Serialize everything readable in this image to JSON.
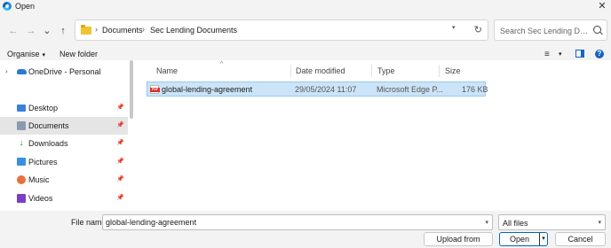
{
  "window": {
    "title": "Open",
    "close_glyph": "✕"
  },
  "nav": {
    "back_glyph": "←",
    "forward_glyph": "→",
    "recent_glyph": "⌄",
    "up_glyph": "↑",
    "refresh_glyph": "↻"
  },
  "address": {
    "breadcrumbs": [
      "Documents",
      "Sec Lending Documents"
    ],
    "separator": "›"
  },
  "search": {
    "placeholder": "Search Sec Lending Documents"
  },
  "toolbar": {
    "organise_label": "Organise",
    "new_folder_label": "New folder",
    "caret": "▾",
    "view_glyph": "≡"
  },
  "sidebar": {
    "items": [
      {
        "label": "OneDrive - Personal",
        "icon": "onedrive-icon",
        "expander": "›",
        "pinned": false
      },
      {
        "label": "Desktop",
        "icon": "desktop-icon",
        "pinned": true
      },
      {
        "label": "Documents",
        "icon": "documents-icon",
        "pinned": true,
        "selected": true
      },
      {
        "label": "Downloads",
        "icon": "downloads-icon",
        "pinned": true
      },
      {
        "label": "Pictures",
        "icon": "pictures-icon",
        "pinned": true
      },
      {
        "label": "Music",
        "icon": "music-icon",
        "pinned": true
      },
      {
        "label": "Videos",
        "icon": "videos-icon",
        "pinned": true
      }
    ],
    "pin_glyph": "📌"
  },
  "files": {
    "sort_glyph": "^",
    "columns": {
      "name": "Name",
      "date": "Date modified",
      "type": "Type",
      "size": "Size"
    },
    "rows": [
      {
        "name": "global-lending-agreement",
        "date": "29/05/2024 11:07",
        "type": "Microsoft Edge P...",
        "size": "176 KB",
        "icon": "pdf-icon",
        "selected": true
      }
    ]
  },
  "footer": {
    "file_name_label": "File name:",
    "file_name_value": "global-lending-agreement",
    "file_type_value": "All files",
    "upload_label": "Upload from mobile",
    "open_label": "Open",
    "cancel_label": "Cancel",
    "caret": "▾"
  },
  "colors": {
    "accent": "#0067c0",
    "selection": "#cce4f7",
    "nav_selection": "#e5e5e5"
  }
}
